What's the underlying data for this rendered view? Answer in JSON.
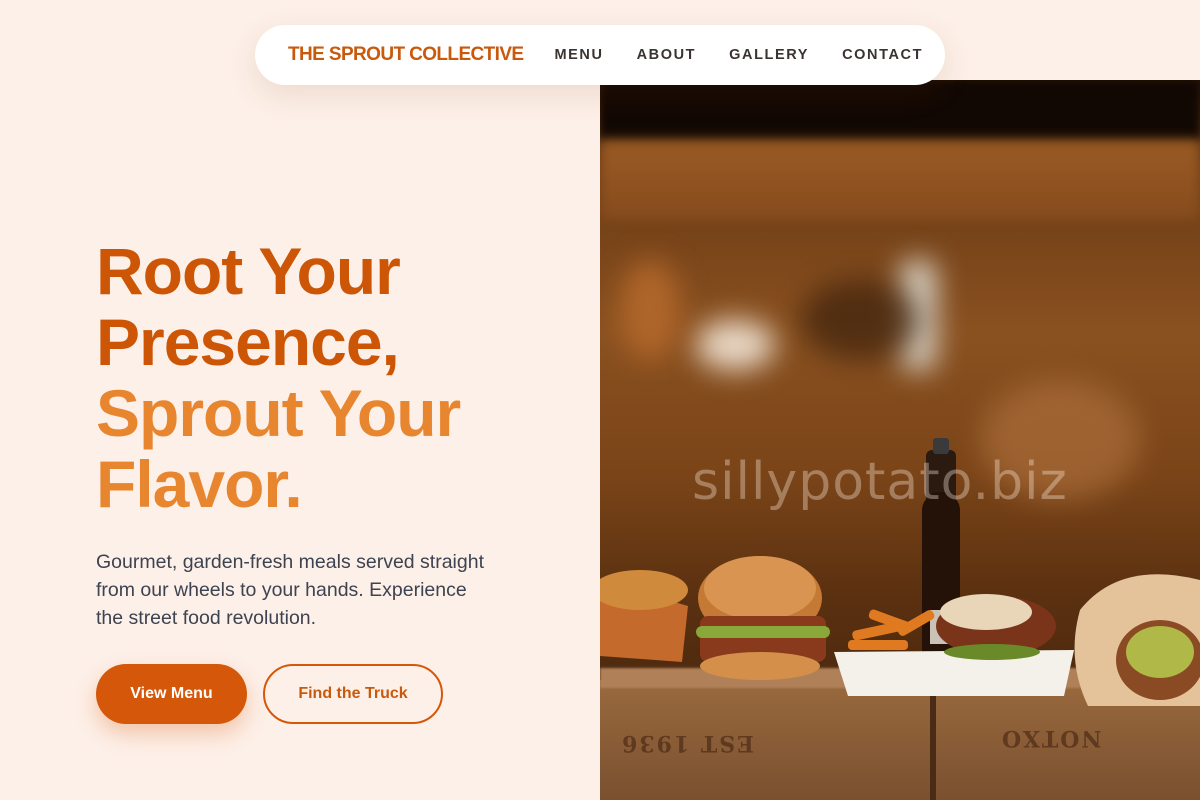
{
  "nav": {
    "brand": "THE SPROUT COLLECTIVE",
    "links": [
      "MENU",
      "ABOUT",
      "GALLERY",
      "CONTACT"
    ]
  },
  "hero": {
    "headline_lines": [
      "Root Your",
      "Presence,",
      "Sprout Your",
      "Flavor."
    ],
    "subtext": "Gourmet, garden-fresh meals served straight from our wheels to your hands. Experience the street food revolution.",
    "primary_button": "View Menu",
    "secondary_button": "Find the Truck",
    "image_watermark": "sillypotato.biz",
    "image_description": "food truck counter with burgers, fries, pulled pork and wraps on wooden crates"
  },
  "colors": {
    "background": "#fdf0e8",
    "accent_dark": "#cc5606",
    "accent_light": "#e8862f",
    "button": "#d55709",
    "nav_text": "#3a3330",
    "body_text": "#3d4350"
  }
}
